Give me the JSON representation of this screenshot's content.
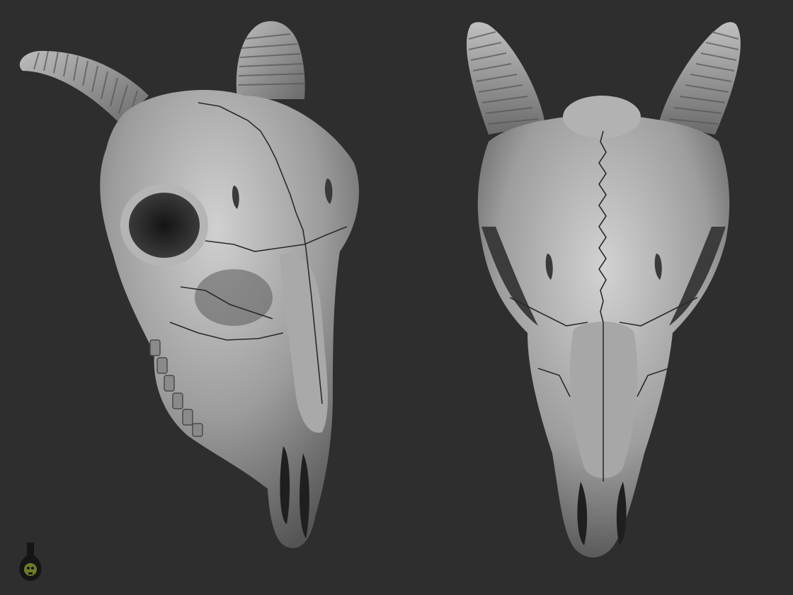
{
  "scene": {
    "background": "#2e2e2f",
    "bone": "#8e8e8e",
    "bone_light": "#c9c9c9",
    "bone_dark": "#4a4a4a",
    "suture": "#2a2a2a"
  },
  "renders": [
    {
      "name": "goat-skull-three-quarter-view"
    },
    {
      "name": "goat-skull-front-view"
    }
  ],
  "logo": {
    "icon": "skull-flask-icon",
    "glow": "#7c8f2a"
  }
}
